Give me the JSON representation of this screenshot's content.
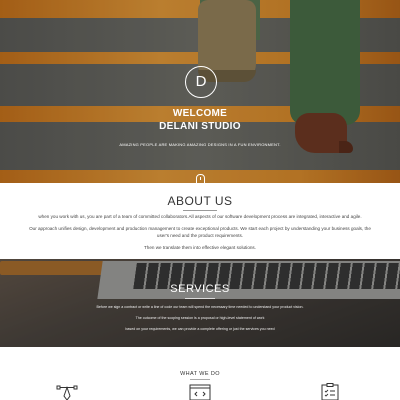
{
  "hero": {
    "logo_letter": "D",
    "title_line1": "WELCOME",
    "title_line2": "DELANI STUDIO",
    "subtitle": "AMAZING PEOPLE ARE MAKING AMAZING DESIGNS IN A FUN ENVIRONMENT."
  },
  "about": {
    "title": "ABOUT US",
    "paragraphs": [
      "when you work with us, you are part of a team of committed collaborators.All aspects of our software development process are integrated, interactive and agile.",
      "Our approach unifies design, development and production management to create exceptional products. We start each project by understanding your business goals, the",
      "user's need and the product requirements.",
      "Then we translate them into effective elegant solutions."
    ]
  },
  "services": {
    "title": "SERVICES",
    "lines": [
      "Before we sign a contract or write a line of code our team will spend the necessary time needed to understand your product vision.",
      "The outcome of the scoping session is a proposal or high-level statement of work",
      "based on your requirements, we can provide a complete offering or just the services you need"
    ]
  },
  "what_we_do": {
    "title": "WHAT WE DO"
  },
  "icons": [
    "scroll-down-icon",
    "design-pen-icon",
    "code-window-icon",
    "checklist-icon"
  ]
}
